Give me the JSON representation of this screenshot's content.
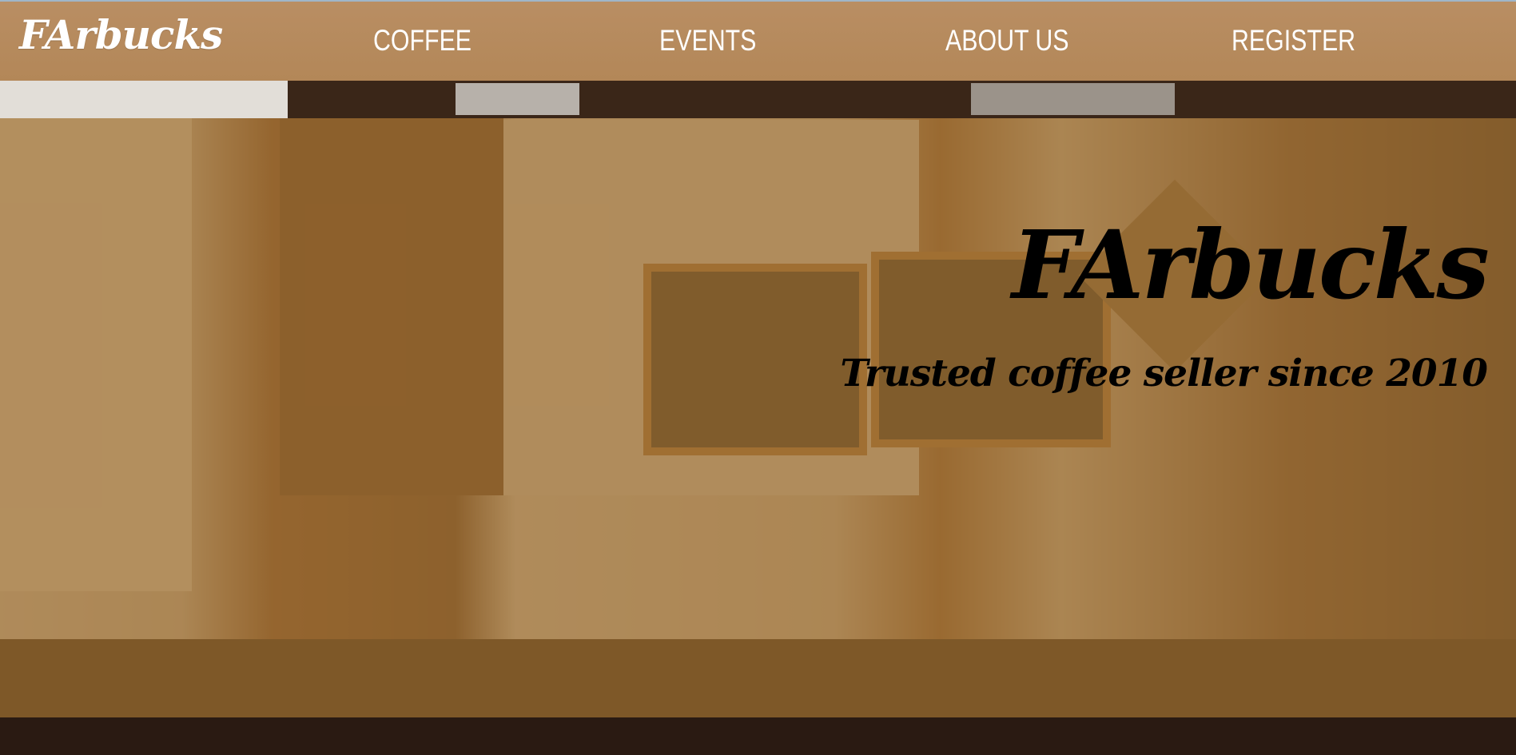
{
  "header": {
    "brand": "FArbucks",
    "nav": [
      {
        "label": "COFFEE"
      },
      {
        "label": "EVENTS"
      },
      {
        "label": "ABOUT US"
      },
      {
        "label": "REGISTER"
      }
    ]
  },
  "hero": {
    "title": "FArbucks",
    "subtitle": "Trusted coffee seller since 2010",
    "background_image": "cafe-counter-photo"
  },
  "colors": {
    "navbar": "#b38758",
    "overlay": "#a07030",
    "nav_text": "#ffffff",
    "hero_text": "#000000"
  }
}
